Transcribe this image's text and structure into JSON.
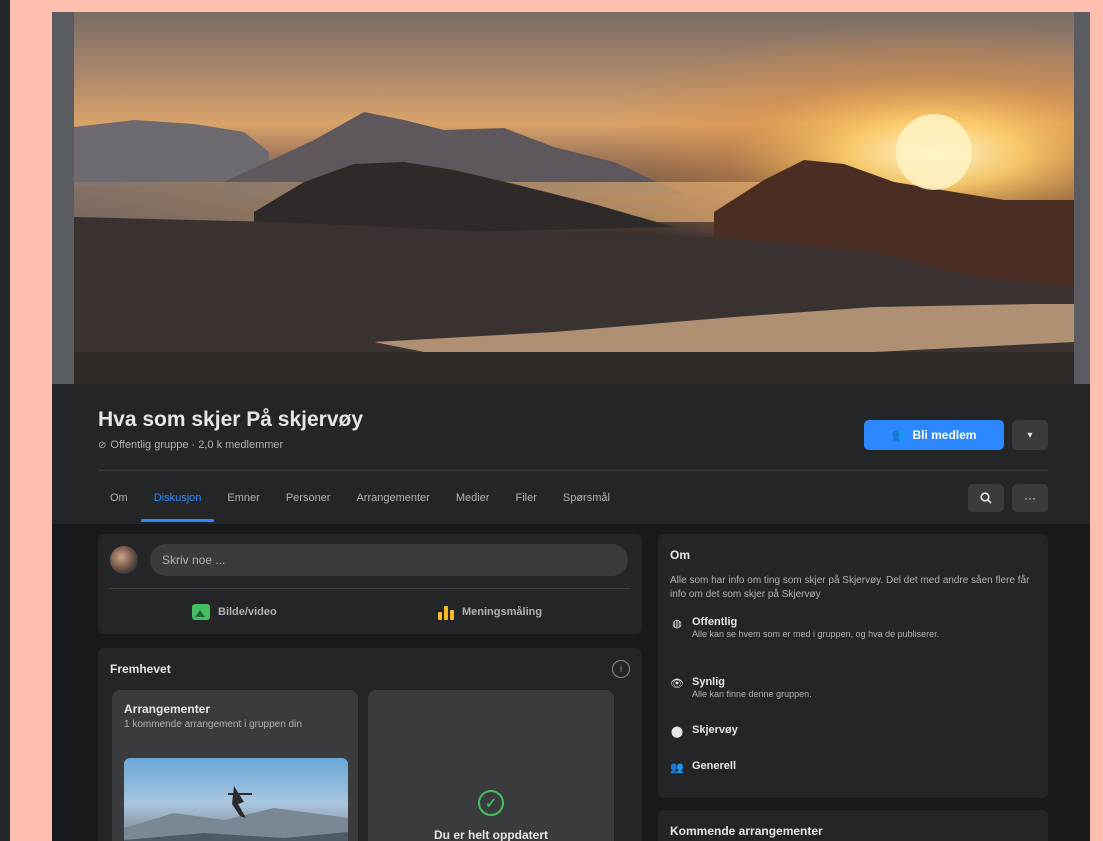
{
  "group": {
    "title": "Hva som skjer På skjervøy",
    "subtitle": "Offentlig gruppe · 2,0 k medlemmer",
    "join_label": "Bli medlem",
    "more_label": "▾"
  },
  "tabs": [
    {
      "label": "Om"
    },
    {
      "label": "Diskusjon"
    },
    {
      "label": "Emner"
    },
    {
      "label": "Personer"
    },
    {
      "label": "Arrangementer"
    },
    {
      "label": "Medier"
    },
    {
      "label": "Filer"
    },
    {
      "label": "Spørsmål"
    }
  ],
  "toolbar": {
    "search_icon": "search-icon",
    "more_icon": "ellipsis-icon",
    "more_label": "···"
  },
  "composer": {
    "placeholder": "Skriv noe ...",
    "photo_label": "Bilde/video",
    "poll_label": "Meningsmåling"
  },
  "featured": {
    "title": "Fremhevet",
    "info_label": "i",
    "events_title": "Arrangementer",
    "events_desc": "1 kommende arrangement i gruppen din",
    "check_label": "✓",
    "uptodate_text": "Du er helt oppdatert"
  },
  "about": {
    "title": "Om",
    "description": "Alle som har info om ting som skjer på Skjervøy. Del det med andre såen flere får info om det som skjer på Skjervøy",
    "public_title": "Offentlig",
    "public_desc": "Alle kan se hvem som er med i gruppen, og hva de publiserer.",
    "visible_title": "Synlig",
    "visible_desc": "Alle kan finne denne gruppen.",
    "place": "Skjervøy",
    "general": "Generell"
  },
  "upcoming": {
    "title": "Kommende arrangementer"
  },
  "colors": {
    "accent": "#2d88ff",
    "background": "#18191a",
    "card": "#242526",
    "page_bg": "#ffbfae"
  }
}
